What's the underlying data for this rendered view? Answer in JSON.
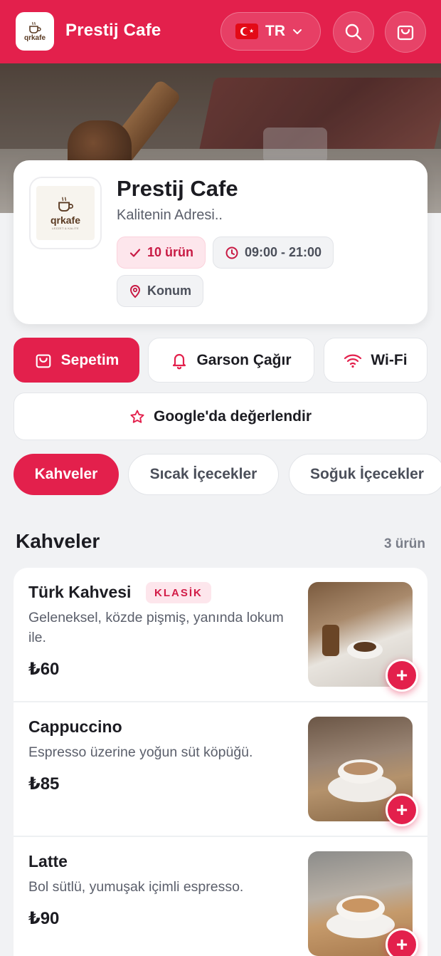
{
  "header": {
    "logo_text": "qrkafe",
    "brand": "Prestij Cafe",
    "language_code": "TR",
    "icons": [
      "coffee-cup-icon",
      "chevron-down-icon",
      "search-icon",
      "shopping-bag-icon"
    ]
  },
  "info": {
    "name": "Prestij Cafe",
    "slogan": "Kalitenin Adresi..",
    "logo_text": "qrkafe",
    "logo_subtext": "LEZZET & KALİTE",
    "product_count": "10 ürün",
    "hours": "09:00 - 21:00",
    "location": "Konum"
  },
  "actions": {
    "basket": "Sepetim",
    "waiter": "Garson Çağır",
    "wifi": "Wi-Fi",
    "google": "Google'da değerlendir"
  },
  "categories": [
    "Kahveler",
    "Sıcak İçecekler",
    "Soğuk İçecekler"
  ],
  "section": {
    "title": "Kahveler",
    "count": "3 ürün"
  },
  "products": [
    {
      "name": "Türk Kahvesi",
      "badge": "KLASİK",
      "description": "Geleneksel, közde pişmiş, yanında lokum ile.",
      "price": "₺60"
    },
    {
      "name": "Cappuccino",
      "description": "Espresso üzerine yoğun süt köpüğü.",
      "price": "₺85"
    },
    {
      "name": "Latte",
      "description": "Bol sütlü, yumuşak içimli espresso.",
      "price": "₺90"
    }
  ],
  "colors": {
    "primary": "#e3204c",
    "badge_bg": "#fde6ec",
    "background": "#f1f2f4"
  }
}
